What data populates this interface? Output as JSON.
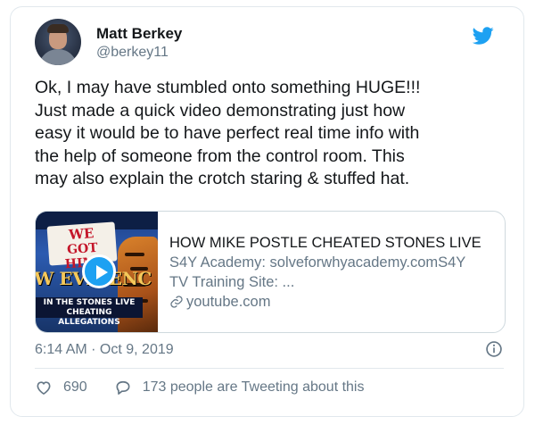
{
  "tweet": {
    "author_name": "Matt Berkey",
    "author_handle": "@berkey11",
    "text": "Ok, I may have stumbled onto something HUGE!!!\nJust made a quick video demonstrating just how\neasy it would be to have perfect real time info with\nthe help of someone from the control room. This\nmay also explain the crotch staring & stuffed hat.",
    "timestamp": "6:14 AM · Oct 9, 2019"
  },
  "link_card": {
    "title": "HOW MIKE POSTLE CHEATED STONES LIVE",
    "description_line1": "S4Y Academy: solveforwhyacademy.comS4Y",
    "description_line2": "TV Training Site: ...",
    "domain": "youtube.com",
    "thumbnail": {
      "sign_line1": "WE",
      "sign_line2": "GOT HIM!",
      "overlay_big": "W EVIDENC",
      "banner_line1": "IN THE STONES LIVE",
      "banner_line2": "CHEATING ALLEGATIONS"
    }
  },
  "actions": {
    "like_count": "690",
    "tweeting_text": "173 people are Tweeting about this"
  },
  "icons": {
    "brand": "twitter-bird-icon",
    "play": "play-icon",
    "link": "link-icon",
    "info": "info-icon",
    "like": "heart-icon",
    "reply": "speech-bubble-icon"
  },
  "colors": {
    "accent": "#1da1f2",
    "secondary_text": "#657786",
    "primary_text": "#14171a",
    "border": "#e1e8ed"
  }
}
